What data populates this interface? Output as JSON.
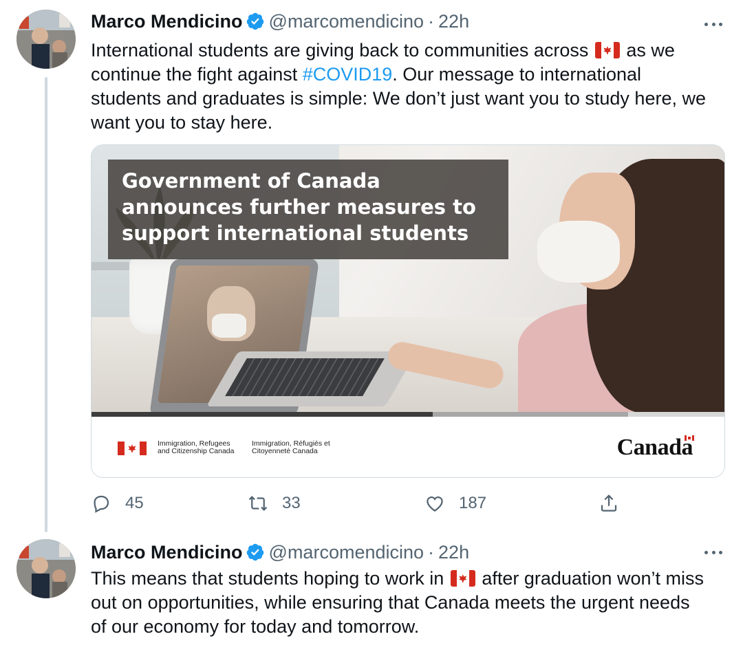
{
  "tweets": [
    {
      "author_name": "Marco Mendicino",
      "handle": "@marcomendicino",
      "separator": "·",
      "time": "22h",
      "text_parts": {
        "a": "International students are giving back to communities across",
        "b": "as we continue the fight against",
        "hashtag": "#COVID19",
        "c": ". Our message to international students and graduates is simple: We don’t just want you to study here, we want you to stay here."
      },
      "card": {
        "overlay_title": "Government of Canada announces further measures to support international students",
        "dept_en": "Immigration, Refugees and Citizenship Canada",
        "dept_fr": "Immigration, Réfugiés et Citoyenneté Canada",
        "wordmark": "Canada"
      },
      "actions": {
        "replies": "45",
        "retweets": "33",
        "likes": "187"
      }
    },
    {
      "author_name": "Marco Mendicino",
      "handle": "@marcomendicino",
      "separator": "·",
      "time": "22h",
      "text_parts": {
        "a": "This means that students hoping to work in",
        "b": "after graduation won’t miss out on opportunities, while ensuring that Canada meets the urgent needs of our economy for today and tomorrow."
      }
    }
  ],
  "colors": {
    "link": "#1d9bf0",
    "muted": "#536471",
    "verified": "#1d9bf0",
    "canada_red": "#d52b1e"
  },
  "icons": {
    "verified": "verified-badge-icon",
    "more": "more-dots-icon",
    "reply": "reply-bubble-icon",
    "retweet": "retweet-arrows-icon",
    "like": "heart-icon",
    "share": "share-upload-icon",
    "flag": "canada-flag-icon"
  }
}
